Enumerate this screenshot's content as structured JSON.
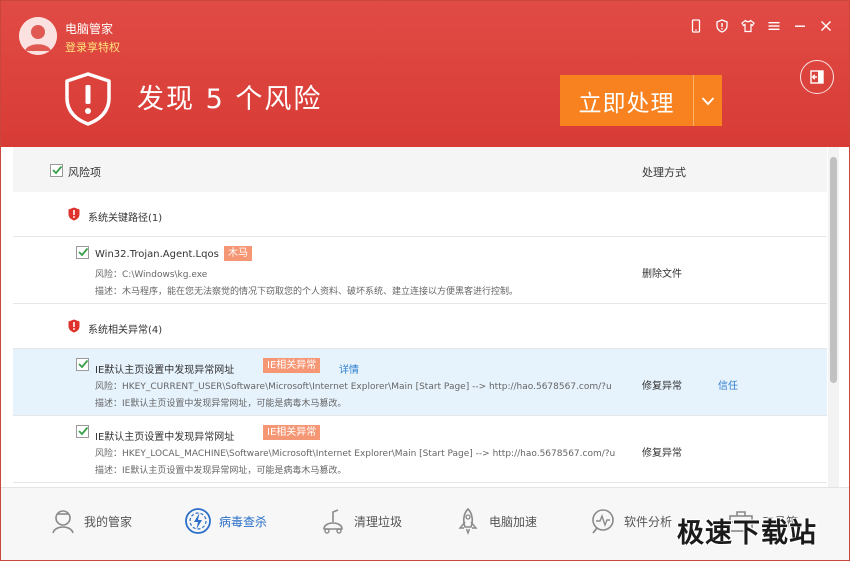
{
  "header": {
    "app_name": "电脑管家",
    "login_link": "登录享特权",
    "headline": "发现 5 个风险",
    "fix_button": "立即处理"
  },
  "list_header": {
    "risk_col": "风险项",
    "action_col": "处理方式"
  },
  "groups": [
    {
      "title": "系统关键路径(1)",
      "items": [
        {
          "name": "Win32.Trojan.Agent.Lqos",
          "tag": "木马",
          "risk_line": "风险：C:\\Windows\\kg.exe",
          "desc_line": "描述：木马程序，能在您无法察觉的情况下窃取您的个人资料、破坏系统、建立连接以方便黑客进行控制。",
          "action": "删除文件"
        }
      ]
    },
    {
      "title": "系统相关异常(4)",
      "items": [
        {
          "name": "IE默认主页设置中发现异常网址",
          "tag": "IE相关异常",
          "detail": "详情",
          "risk_line": "风险：HKEY_CURRENT_USER\\Software\\Microsoft\\Internet Explorer\\Main [Start Page] --> http://hao.5678567.com/?u",
          "desc_line": "描述：IE默认主页设置中发现异常网址，可能是病毒木马篡改。",
          "action": "修复异常",
          "trust": "信任"
        },
        {
          "name": "IE默认主页设置中发现异常网址",
          "tag": "IE相关异常",
          "risk_line": "风险：HKEY_LOCAL_MACHINE\\Software\\Microsoft\\Internet Explorer\\Main [Start Page] --> http://hao.5678567.com/?u",
          "desc_line": "描述：IE默认主页设置中发现异常网址，可能是病毒木马篡改。",
          "action": "修复异常"
        }
      ]
    }
  ],
  "bottom_nav": [
    {
      "label": "我的管家",
      "icon": "home-icon"
    },
    {
      "label": "病毒查杀",
      "icon": "virus-scan-icon",
      "active": true
    },
    {
      "label": "清理垃圾",
      "icon": "cleanup-icon"
    },
    {
      "label": "电脑加速",
      "icon": "rocket-icon"
    },
    {
      "label": "软件分析",
      "icon": "software-analysis-icon"
    },
    {
      "label": "工具箱",
      "icon": "toolbox-icon"
    }
  ],
  "watermark": "极速下载站",
  "colors": {
    "header_red": "#da3f39",
    "fix_orange": "#f7821f",
    "tag_salmon": "#f59674",
    "highlight_row": "#e6f2fc",
    "link_blue": "#2f7fce",
    "active_nav": "#2b6fc9",
    "check_green": "#3aa14a"
  }
}
